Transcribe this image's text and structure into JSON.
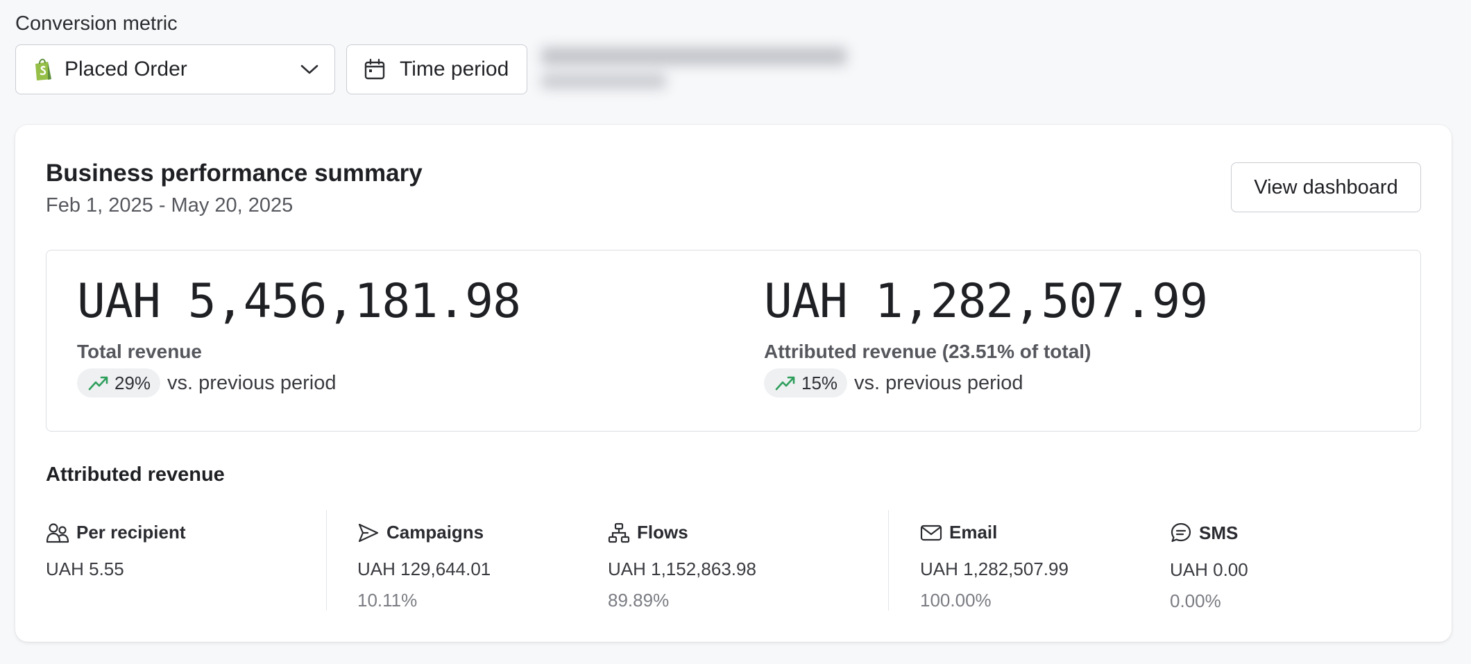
{
  "conversion_metric": {
    "label": "Conversion metric",
    "selected": "Placed Order",
    "time_period_label": "Time period",
    "icons": {
      "metric": "shopify-bag-icon",
      "dropdown": "chevron-down-icon",
      "period": "calendar-icon"
    }
  },
  "summary": {
    "title": "Business performance summary",
    "date_range": "Feb 1, 2025 - May 20, 2025",
    "view_dashboard_label": "View dashboard",
    "total": {
      "value": "UAH 5,456,181.98",
      "caption": "Total revenue",
      "change": "29%",
      "change_suffix": "vs. previous period"
    },
    "attributed": {
      "value": "UAH 1,282,507.99",
      "caption": "Attributed revenue (23.51% of total)",
      "change": "15%",
      "change_suffix": "vs. previous period"
    }
  },
  "attributed_revenue": {
    "title": "Attributed revenue",
    "per_recipient": {
      "label": "Per recipient",
      "value": "UAH 5.55",
      "icon": "people-icon"
    },
    "campaigns": {
      "label": "Campaigns",
      "value": "UAH 129,644.01",
      "pct": "10.11%",
      "icon": "send-icon"
    },
    "flows": {
      "label": "Flows",
      "value": "UAH 1,152,863.98",
      "pct": "89.89%",
      "icon": "flow-icon"
    },
    "email": {
      "label": "Email",
      "value": "UAH 1,282,507.99",
      "pct": "100.00%",
      "icon": "mail-icon"
    },
    "sms": {
      "label": "SMS",
      "value": "UAH 0.00",
      "pct": "0.00%",
      "icon": "chat-icon"
    }
  },
  "colors": {
    "trend_up": "#2e9e5b",
    "shopify_green": "#95bf47",
    "card_bg": "#ffffff",
    "page_bg": "#f7f8fa"
  }
}
